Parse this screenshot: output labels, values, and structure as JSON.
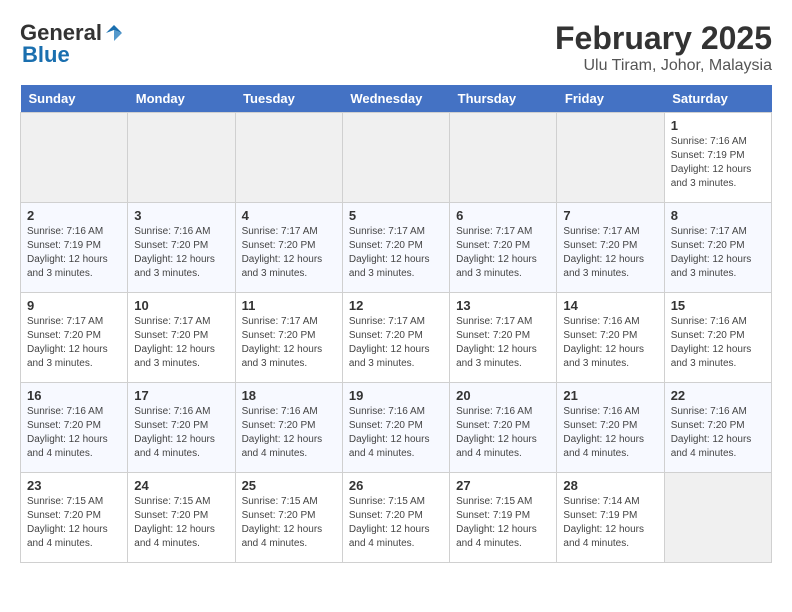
{
  "header": {
    "logo_general": "General",
    "logo_blue": "Blue",
    "title": "February 2025",
    "subtitle": "Ulu Tiram, Johor, Malaysia"
  },
  "days_of_week": [
    "Sunday",
    "Monday",
    "Tuesday",
    "Wednesday",
    "Thursday",
    "Friday",
    "Saturday"
  ],
  "weeks": [
    [
      {
        "day": "",
        "info": ""
      },
      {
        "day": "",
        "info": ""
      },
      {
        "day": "",
        "info": ""
      },
      {
        "day": "",
        "info": ""
      },
      {
        "day": "",
        "info": ""
      },
      {
        "day": "",
        "info": ""
      },
      {
        "day": "1",
        "info": "Sunrise: 7:16 AM\nSunset: 7:19 PM\nDaylight: 12 hours\nand 3 minutes."
      }
    ],
    [
      {
        "day": "2",
        "info": "Sunrise: 7:16 AM\nSunset: 7:19 PM\nDaylight: 12 hours\nand 3 minutes."
      },
      {
        "day": "3",
        "info": "Sunrise: 7:16 AM\nSunset: 7:20 PM\nDaylight: 12 hours\nand 3 minutes."
      },
      {
        "day": "4",
        "info": "Sunrise: 7:17 AM\nSunset: 7:20 PM\nDaylight: 12 hours\nand 3 minutes."
      },
      {
        "day": "5",
        "info": "Sunrise: 7:17 AM\nSunset: 7:20 PM\nDaylight: 12 hours\nand 3 minutes."
      },
      {
        "day": "6",
        "info": "Sunrise: 7:17 AM\nSunset: 7:20 PM\nDaylight: 12 hours\nand 3 minutes."
      },
      {
        "day": "7",
        "info": "Sunrise: 7:17 AM\nSunset: 7:20 PM\nDaylight: 12 hours\nand 3 minutes."
      },
      {
        "day": "8",
        "info": "Sunrise: 7:17 AM\nSunset: 7:20 PM\nDaylight: 12 hours\nand 3 minutes."
      }
    ],
    [
      {
        "day": "9",
        "info": "Sunrise: 7:17 AM\nSunset: 7:20 PM\nDaylight: 12 hours\nand 3 minutes."
      },
      {
        "day": "10",
        "info": "Sunrise: 7:17 AM\nSunset: 7:20 PM\nDaylight: 12 hours\nand 3 minutes."
      },
      {
        "day": "11",
        "info": "Sunrise: 7:17 AM\nSunset: 7:20 PM\nDaylight: 12 hours\nand 3 minutes."
      },
      {
        "day": "12",
        "info": "Sunrise: 7:17 AM\nSunset: 7:20 PM\nDaylight: 12 hours\nand 3 minutes."
      },
      {
        "day": "13",
        "info": "Sunrise: 7:17 AM\nSunset: 7:20 PM\nDaylight: 12 hours\nand 3 minutes."
      },
      {
        "day": "14",
        "info": "Sunrise: 7:16 AM\nSunset: 7:20 PM\nDaylight: 12 hours\nand 3 minutes."
      },
      {
        "day": "15",
        "info": "Sunrise: 7:16 AM\nSunset: 7:20 PM\nDaylight: 12 hours\nand 3 minutes."
      }
    ],
    [
      {
        "day": "16",
        "info": "Sunrise: 7:16 AM\nSunset: 7:20 PM\nDaylight: 12 hours\nand 4 minutes."
      },
      {
        "day": "17",
        "info": "Sunrise: 7:16 AM\nSunset: 7:20 PM\nDaylight: 12 hours\nand 4 minutes."
      },
      {
        "day": "18",
        "info": "Sunrise: 7:16 AM\nSunset: 7:20 PM\nDaylight: 12 hours\nand 4 minutes."
      },
      {
        "day": "19",
        "info": "Sunrise: 7:16 AM\nSunset: 7:20 PM\nDaylight: 12 hours\nand 4 minutes."
      },
      {
        "day": "20",
        "info": "Sunrise: 7:16 AM\nSunset: 7:20 PM\nDaylight: 12 hours\nand 4 minutes."
      },
      {
        "day": "21",
        "info": "Sunrise: 7:16 AM\nSunset: 7:20 PM\nDaylight: 12 hours\nand 4 minutes."
      },
      {
        "day": "22",
        "info": "Sunrise: 7:16 AM\nSunset: 7:20 PM\nDaylight: 12 hours\nand 4 minutes."
      }
    ],
    [
      {
        "day": "23",
        "info": "Sunrise: 7:15 AM\nSunset: 7:20 PM\nDaylight: 12 hours\nand 4 minutes."
      },
      {
        "day": "24",
        "info": "Sunrise: 7:15 AM\nSunset: 7:20 PM\nDaylight: 12 hours\nand 4 minutes."
      },
      {
        "day": "25",
        "info": "Sunrise: 7:15 AM\nSunset: 7:20 PM\nDaylight: 12 hours\nand 4 minutes."
      },
      {
        "day": "26",
        "info": "Sunrise: 7:15 AM\nSunset: 7:20 PM\nDaylight: 12 hours\nand 4 minutes."
      },
      {
        "day": "27",
        "info": "Sunrise: 7:15 AM\nSunset: 7:19 PM\nDaylight: 12 hours\nand 4 minutes."
      },
      {
        "day": "28",
        "info": "Sunrise: 7:14 AM\nSunset: 7:19 PM\nDaylight: 12 hours\nand 4 minutes."
      },
      {
        "day": "",
        "info": ""
      }
    ]
  ]
}
